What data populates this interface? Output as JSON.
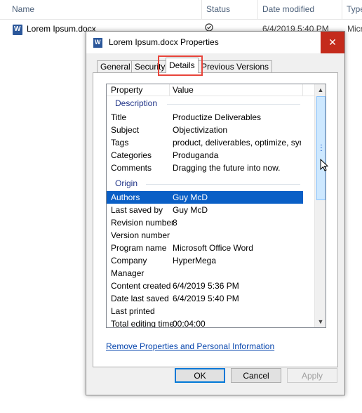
{
  "explorer": {
    "columns": [
      "Name",
      "Status",
      "Date modified",
      "Type"
    ],
    "file": {
      "name": "Lorem Ipsum.docx",
      "status_icon": "sync-check-icon",
      "date_modified": "6/4/2019 5:40 PM",
      "type": "Micr"
    }
  },
  "dialog": {
    "title": "Lorem Ipsum.docx Properties",
    "close_glyph": "✕",
    "tabs": [
      "General",
      "Security",
      "Details",
      "Previous Versions"
    ],
    "active_tab": "Details",
    "list": {
      "header_property": "Property",
      "header_value": "Value",
      "groups": [
        {
          "name": "Description",
          "rows": [
            {
              "label": "Title",
              "value": "Productize Deliverables"
            },
            {
              "label": "Subject",
              "value": "Objectivization"
            },
            {
              "label": "Tags",
              "value": "product, deliverables, optimize, sync..."
            },
            {
              "label": "Categories",
              "value": "Produganda"
            },
            {
              "label": "Comments",
              "value": "Dragging the future into now."
            }
          ]
        },
        {
          "name": "Origin",
          "rows": [
            {
              "label": "Authors",
              "value": "Guy McD",
              "selected": true
            },
            {
              "label": "Last saved by",
              "value": "Guy McD"
            },
            {
              "label": "Revision number",
              "value": "8"
            },
            {
              "label": "Version number",
              "value": ""
            },
            {
              "label": "Program name",
              "value": "Microsoft Office Word"
            },
            {
              "label": "Company",
              "value": "HyperMega"
            },
            {
              "label": "Manager",
              "value": ""
            },
            {
              "label": "Content created",
              "value": "6/4/2019 5:36 PM"
            },
            {
              "label": "Date last saved",
              "value": "6/4/2019 5:40 PM"
            },
            {
              "label": "Last printed",
              "value": ""
            },
            {
              "label": "Total editing time",
              "value": "00:04:00"
            }
          ]
        }
      ]
    },
    "remove_link": "Remove Properties and Personal Information",
    "buttons": {
      "ok": "OK",
      "cancel": "Cancel",
      "apply": "Apply"
    },
    "colors": {
      "selection": "#0a5fc6",
      "highlight_box": "#e8443a",
      "close_button": "#c42b1c"
    }
  }
}
